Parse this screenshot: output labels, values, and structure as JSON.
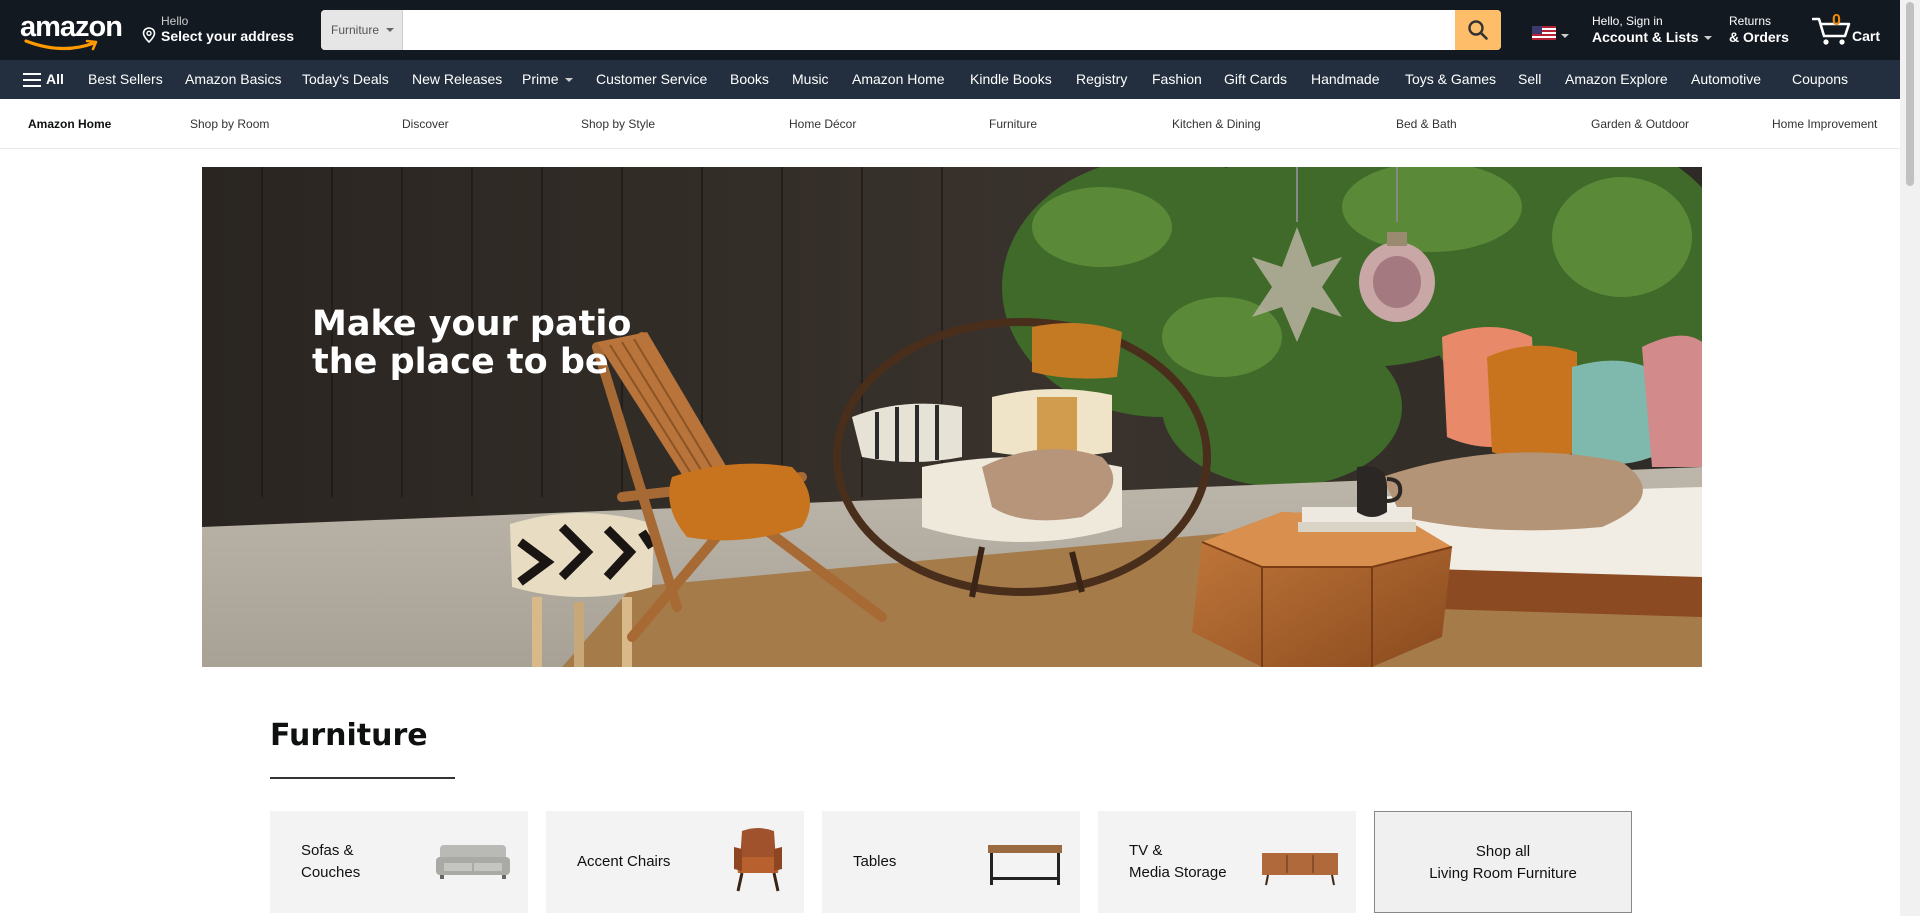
{
  "header": {
    "logo_text": "amazon",
    "deliver": {
      "line1": "Hello",
      "line2": "Select your address"
    },
    "search": {
      "category": "Furniture",
      "placeholder": "",
      "value": ""
    },
    "account": {
      "line1": "Hello, Sign in",
      "line2": "Account & Lists"
    },
    "returns": {
      "line1": "Returns",
      "line2": "& Orders"
    },
    "cart": {
      "count": "0",
      "label": "Cart"
    },
    "accent_color": "#febd69",
    "bg_color": "#131921"
  },
  "main_nav": {
    "all_label": "All",
    "items": [
      "Best Sellers",
      "Amazon Basics",
      "Today's Deals",
      "New Releases",
      "Prime",
      "Customer Service",
      "Books",
      "Music",
      "Amazon Home",
      "Kindle Books",
      "Registry",
      "Fashion",
      "Gift Cards",
      "Handmade",
      "Toys & Games",
      "Sell",
      "Amazon Explore",
      "Automotive",
      "Coupons"
    ],
    "bg_color": "#232f3e"
  },
  "sub_nav": {
    "items": [
      "Amazon Home",
      "Shop by Room",
      "Discover",
      "Shop by Style",
      "Home Décor",
      "Furniture",
      "Kitchen & Dining",
      "Bed & Bath",
      "Garden & Outdoor",
      "Home Improvement"
    ]
  },
  "hero": {
    "headline_line1": "Make your patio",
    "headline_line2": "the place to be"
  },
  "section": {
    "title": "Furniture",
    "cards": [
      {
        "line1": "Sofas &",
        "line2": "Couches",
        "icon": "sofa-icon"
      },
      {
        "line1": "Accent Chairs",
        "line2": "",
        "icon": "accent-chair-icon"
      },
      {
        "line1": "Tables",
        "line2": "",
        "icon": "table-icon"
      },
      {
        "line1": "TV &",
        "line2": "Media Storage",
        "icon": "media-console-icon"
      },
      {
        "line1": "Shop all",
        "line2": "Living Room Furniture",
        "icon": ""
      }
    ]
  }
}
